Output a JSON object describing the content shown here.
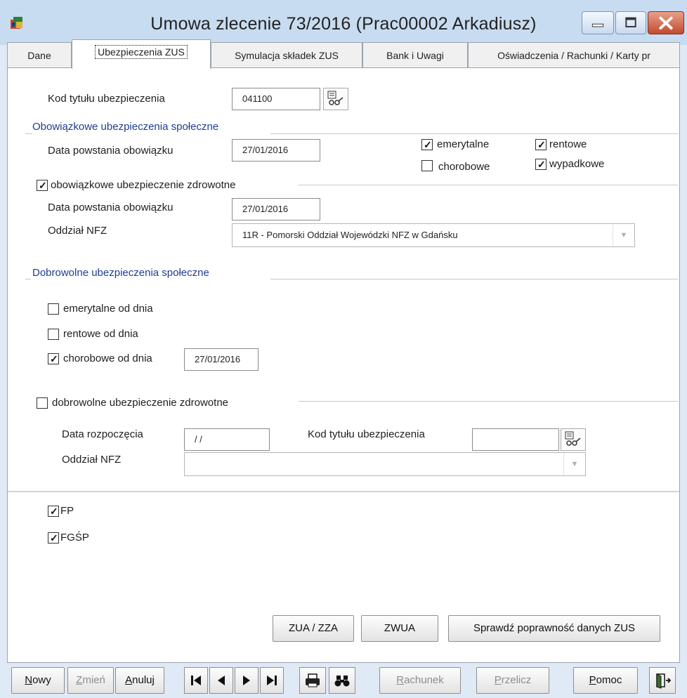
{
  "window": {
    "title": "Umowa zlecenie 73/2016 (Prac00002 Arkadiusz)",
    "icons": [
      "app-icon",
      "minimize-icon",
      "maximize-icon",
      "close-icon"
    ],
    "close_color": "#c9482c"
  },
  "tabs": [
    {
      "label": "Dane",
      "active": false
    },
    {
      "label": "Ubezpieczenia ZUS",
      "active": true
    },
    {
      "label": "Symulacja składek ZUS",
      "active": false
    },
    {
      "label": "Bank i Uwagi",
      "active": false
    },
    {
      "label": "Oświadczenia / Rachunki / Karty pr",
      "active": false
    }
  ],
  "form": {
    "kod_tytulu_label": "Kod tytułu ubezpieczenia",
    "kod_tytulu_value": "041100",
    "obowiazkowe_spoleczne": {
      "heading": "Obowiązkowe ubezpieczenia społeczne",
      "data_label": "Data powstania obowiązku",
      "data_value": "27/01/2016",
      "checks": [
        {
          "label": "emerytalne",
          "checked": true
        },
        {
          "label": "rentowe",
          "checked": true
        },
        {
          "label": "chorobowe",
          "checked": false
        },
        {
          "label": "wypadkowe",
          "checked": true
        }
      ]
    },
    "obowiazkowe_zdrowotne": {
      "label": "obowiązkowe ubezpieczenie zdrowotne",
      "checked": true,
      "data_label": "Data powstania obowiązku",
      "data_value": "27/01/2016",
      "nfz_label": "Oddział NFZ",
      "nfz_value": "11R - Pomorski Oddział Wojewódzki NFZ w Gdańsku"
    },
    "dobrowolne_spoleczne": {
      "heading": "Dobrowolne ubezpieczenia społeczne",
      "emerytalne": {
        "label": "emerytalne od dnia",
        "checked": false
      },
      "rentowe": {
        "label": "rentowe od dnia",
        "checked": false
      },
      "chorobowe": {
        "label": "chorobowe od dnia",
        "checked": true,
        "value": "27/01/2016"
      }
    },
    "dobrowolne_zdrowotne": {
      "label": "dobrowolne ubezpieczenie zdrowotne",
      "checked": false,
      "data_label": "Data rozpoczęcia",
      "data_value": "/ /",
      "kod_label": "Kod tytułu ubezpieczenia",
      "kod_value": "",
      "nfz_label": "Oddział NFZ",
      "nfz_value": ""
    },
    "fp": {
      "label": "FP",
      "checked": true
    },
    "fgsp": {
      "label": "FGŚP",
      "checked": true
    }
  },
  "panel_buttons": {
    "zua": "ZUA / ZZA",
    "zwua": "ZWUA",
    "sprawdz": "Sprawdź poprawność danych ZUS"
  },
  "bottom": {
    "nowy": "Nowy",
    "zmien": "Zmień",
    "anuluj": "Anuluj",
    "rachunek": "Rachunek",
    "przelicz": "Przelicz",
    "pomoc": "Pomoc",
    "nav_icons": [
      "first-record-icon",
      "prev-record-icon",
      "next-record-icon",
      "last-record-icon",
      "print-icon",
      "find-icon",
      "exit-icon"
    ]
  }
}
